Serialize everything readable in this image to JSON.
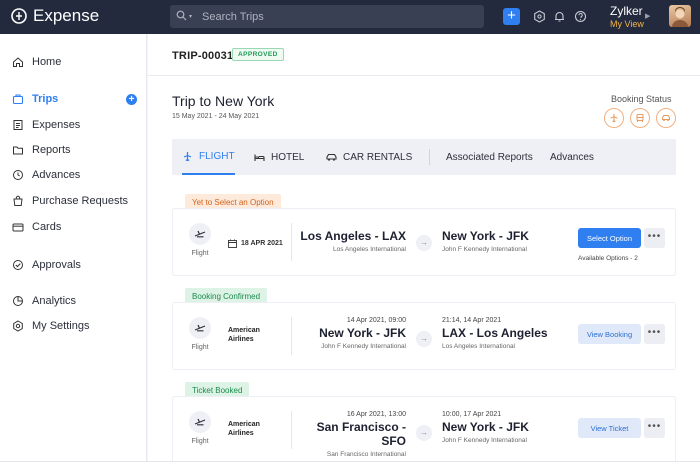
{
  "app": {
    "name": "Expense"
  },
  "search": {
    "placeholder": "Search Trips"
  },
  "user": {
    "name": "Zylker",
    "view": "My View"
  },
  "sidebar": {
    "items": [
      {
        "label": "Home",
        "icon": "home-icon"
      },
      {
        "label": "Trips",
        "icon": "trips-icon",
        "active": true
      },
      {
        "label": "Expenses",
        "icon": "expenses-icon"
      },
      {
        "label": "Reports",
        "icon": "reports-icon"
      },
      {
        "label": "Advances",
        "icon": "advances-icon"
      },
      {
        "label": "Purchase Requests",
        "icon": "purchase-icon"
      },
      {
        "label": "Cards",
        "icon": "cards-icon"
      },
      {
        "label": "Approvals",
        "icon": "approvals-icon"
      },
      {
        "label": "Analytics",
        "icon": "analytics-icon"
      },
      {
        "label": "My Settings",
        "icon": "settings-icon"
      }
    ]
  },
  "trip": {
    "id": "TRIP-00031",
    "status": "APPROVED",
    "title": "Trip to New York",
    "dates": "15 May 2021 - 24 May 2021",
    "booking_status_label": "Booking Status"
  },
  "tabs": [
    {
      "label": "FLIGHT",
      "icon": "flight-icon",
      "active": true
    },
    {
      "label": "HOTEL",
      "icon": "bed-icon"
    },
    {
      "label": "CAR RENTALS",
      "icon": "car-icon"
    },
    {
      "label": "Associated Reports"
    },
    {
      "label": "Advances"
    }
  ],
  "options": [
    {
      "section": "Yet to Select an Option",
      "mode": "Flight",
      "date": "18 APR 2021",
      "from": {
        "time": "",
        "city": "Los Angeles - LAX",
        "airport": "Los Angeles International"
      },
      "to": {
        "time": "",
        "city": "New York - JFK",
        "airport": "John F Kennedy International"
      },
      "action": "Select Option",
      "note": "Available Options - 2"
    },
    {
      "section": "Booking Confirmed",
      "mode": "Flight",
      "carrier": "American Airlines",
      "from": {
        "time": "14 Apr 2021, 09:00",
        "city": "New York - JFK",
        "airport": "John F Kennedy International"
      },
      "to": {
        "time": "21:14, 14 Apr 2021",
        "city": "LAX - Los Angeles",
        "airport": "Los Angeles International"
      },
      "action": "View Booking"
    },
    {
      "section": "Ticket Booked",
      "mode": "Flight",
      "carrier": "American Airlines",
      "from": {
        "time": "16 Apr 2021, 13:00",
        "city": "San Francisco - SFO",
        "airport": "San Francisco International"
      },
      "to": {
        "time": "10:00, 17 Apr 2021",
        "city": "New York - JFK",
        "airport": "John F Kennedy International"
      },
      "action": "View Ticket"
    }
  ],
  "more_label": "•••",
  "colors": {
    "accent": "#2f7ff0",
    "topbar": "#242a3e",
    "approved": "#1d9a55",
    "pending": "#d0631e"
  }
}
